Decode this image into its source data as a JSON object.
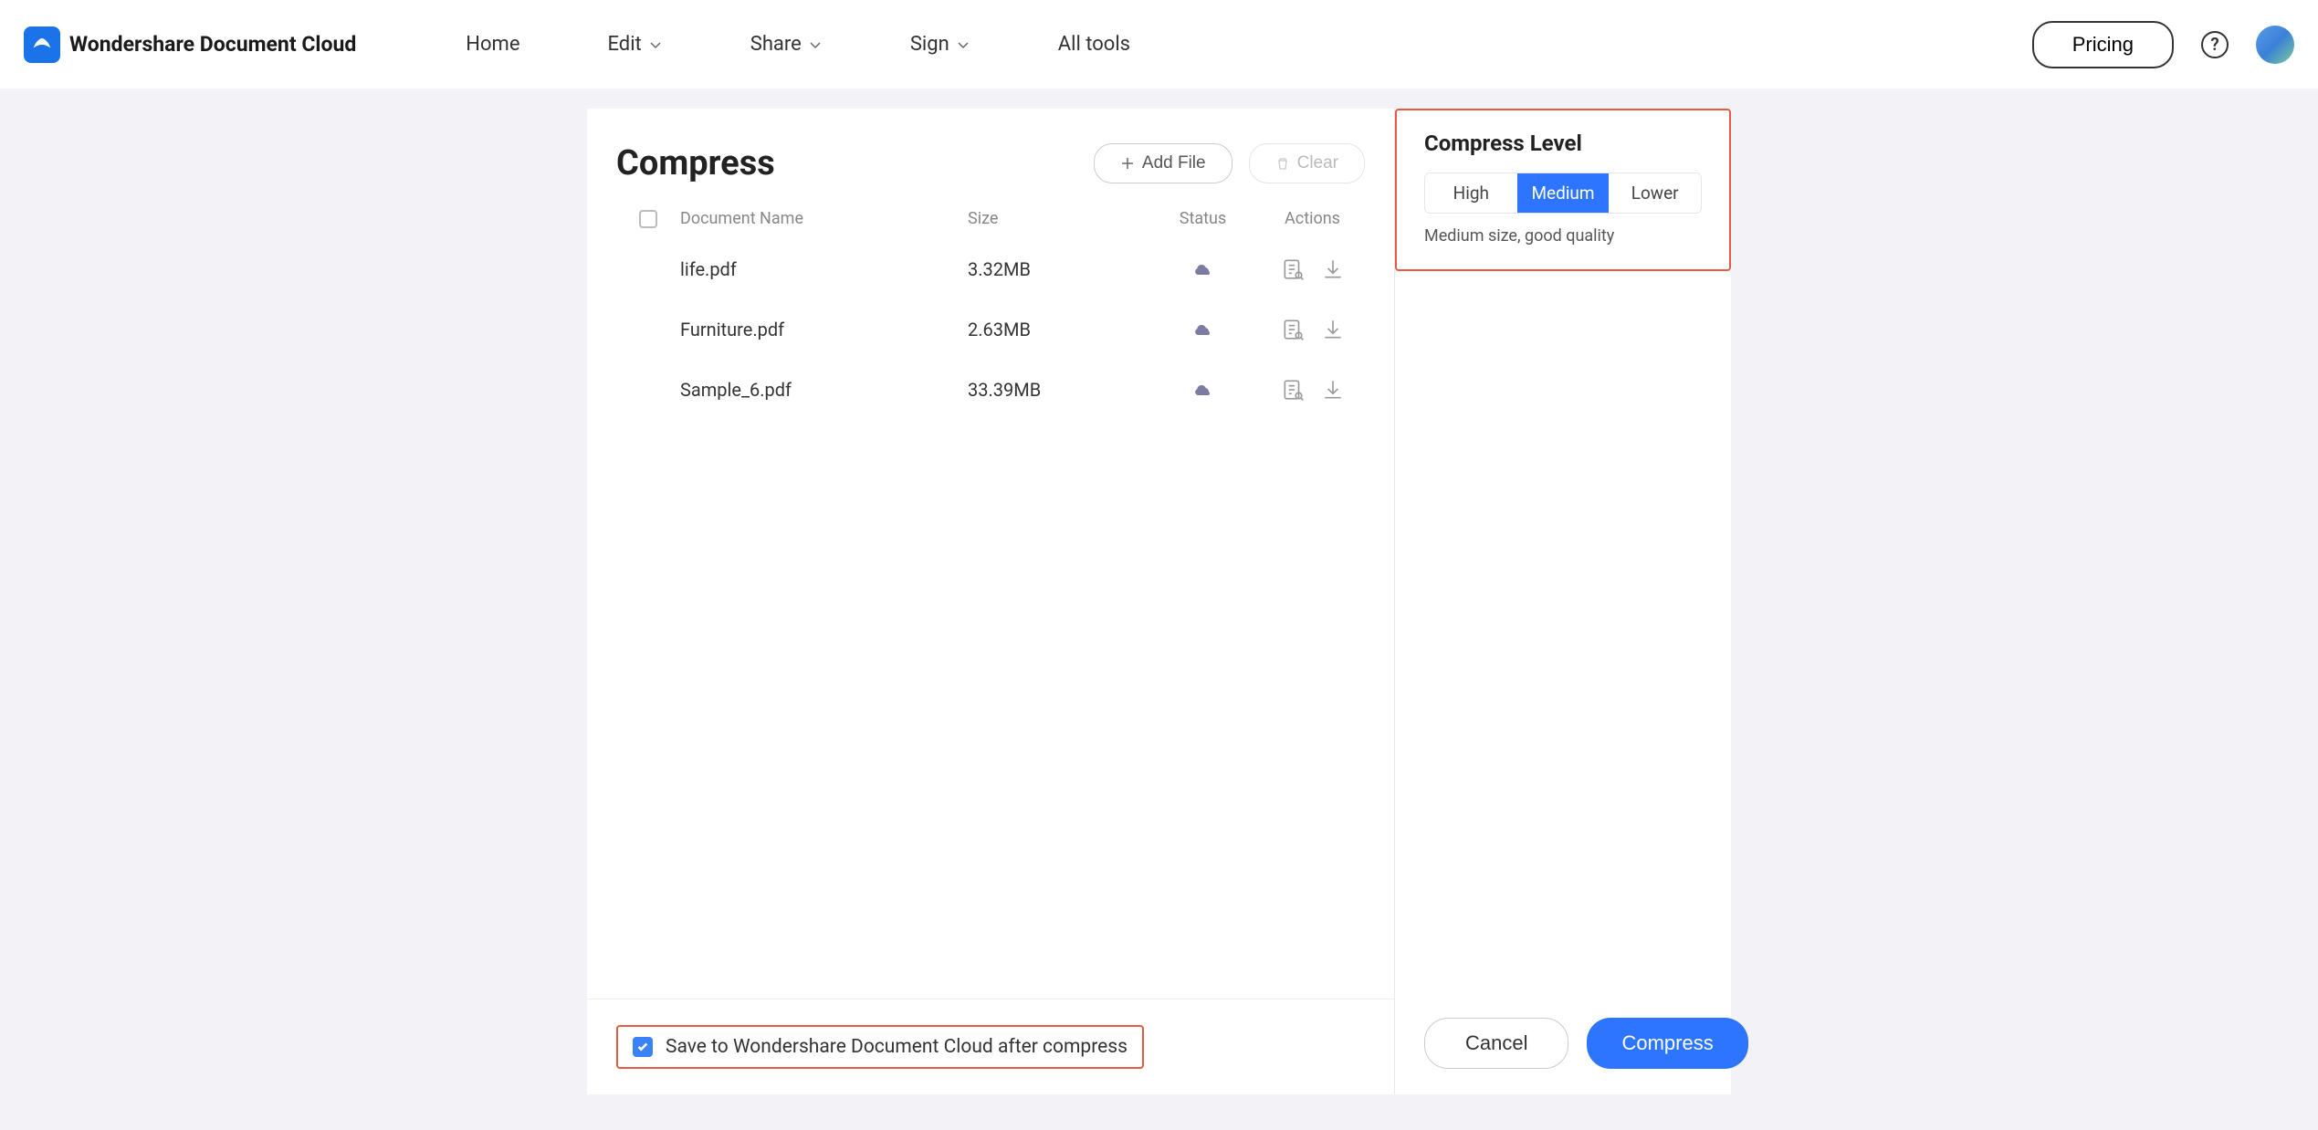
{
  "brand": "Wondershare Document Cloud",
  "nav": {
    "items": [
      "Home",
      "Edit",
      "Share",
      "Sign",
      "All tools"
    ]
  },
  "header": {
    "pricing": "Pricing"
  },
  "main": {
    "title": "Compress",
    "add_file": "Add File",
    "clear": "Clear",
    "columns": {
      "doc_name": "Document Name",
      "size": "Size",
      "status": "Status",
      "actions": "Actions"
    },
    "files": [
      {
        "name": "life.pdf",
        "size": "3.32MB"
      },
      {
        "name": "Furniture.pdf",
        "size": "2.63MB"
      },
      {
        "name": "Sample_6.pdf",
        "size": "33.39MB"
      }
    ],
    "save_label": "Save to Wondershare Document Cloud after compress"
  },
  "level": {
    "title": "Compress Level",
    "options": [
      "High",
      "Medium",
      "Lower"
    ],
    "active": "Medium",
    "desc": "Medium size, good quality"
  },
  "actions": {
    "cancel": "Cancel",
    "compress": "Compress"
  }
}
